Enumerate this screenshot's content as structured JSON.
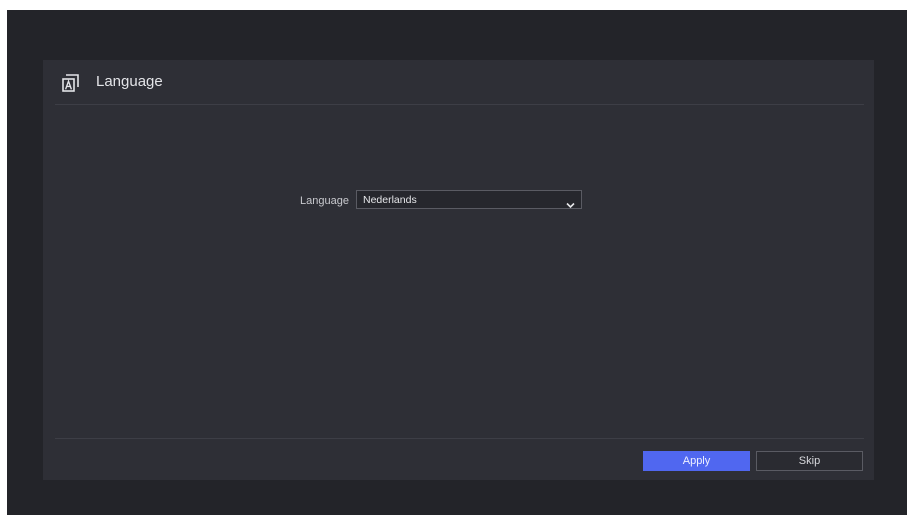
{
  "dialog": {
    "title": "Language",
    "icon": "language-icon"
  },
  "form": {
    "language_label": "Language",
    "language_value": "Nederlands"
  },
  "buttons": {
    "apply_label": "Apply",
    "skip_label": "Skip"
  },
  "colors": {
    "background": "#232429",
    "panel": "#2e2f36",
    "accent": "#5067f0"
  }
}
